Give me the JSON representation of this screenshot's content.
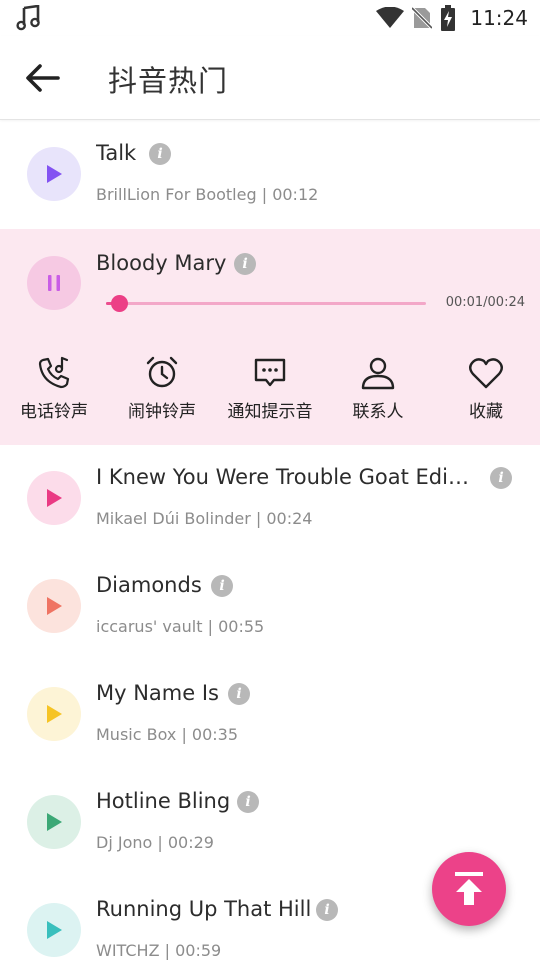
{
  "status_bar": {
    "time": "11:24"
  },
  "header": {
    "title": "抖音热门"
  },
  "expanded_row": {
    "name": "Bloody Mary",
    "time": "00:01/00:24",
    "progress_fraction": 0.042,
    "actions": [
      {
        "label": "电话铃声",
        "icon": "phone-ringtone-icon"
      },
      {
        "label": "闹钟铃声",
        "icon": "alarm-clock-icon"
      },
      {
        "label": "通知提示音",
        "icon": "notification-message-icon"
      },
      {
        "label": "联系人",
        "icon": "contact-person-icon"
      },
      {
        "label": "收藏",
        "icon": "heart-icon"
      }
    ]
  },
  "songs": [
    {
      "name": "Talk",
      "meta": "BrillLion For Bootleg | 00:12",
      "circle": "#e8e4fb",
      "arrow": "#8353f2"
    },
    {
      "name": "I Knew You Were Trouble Goat Editi...",
      "meta": "Mikael Dúi Bolinder | 00:24",
      "circle": "#fcdcea",
      "arrow": "#ea3a84"
    },
    {
      "name": "Diamonds",
      "meta": "iccarus' vault | 00:55",
      "circle": "#fce3dd",
      "arrow": "#ef7463"
    },
    {
      "name": "My Name Is",
      "meta": "Music Box | 00:35",
      "circle": "#fdf4d6",
      "arrow": "#f6c425"
    },
    {
      "name": "Hotline Bling",
      "meta": "Dj Jono | 00:29",
      "circle": "#dcf0e6",
      "arrow": "#3ca876"
    },
    {
      "name": "Running Up That Hill",
      "meta": "WITCHZ | 00:59",
      "circle": "#dcf3f2",
      "arrow": "#39bfbd"
    }
  ]
}
